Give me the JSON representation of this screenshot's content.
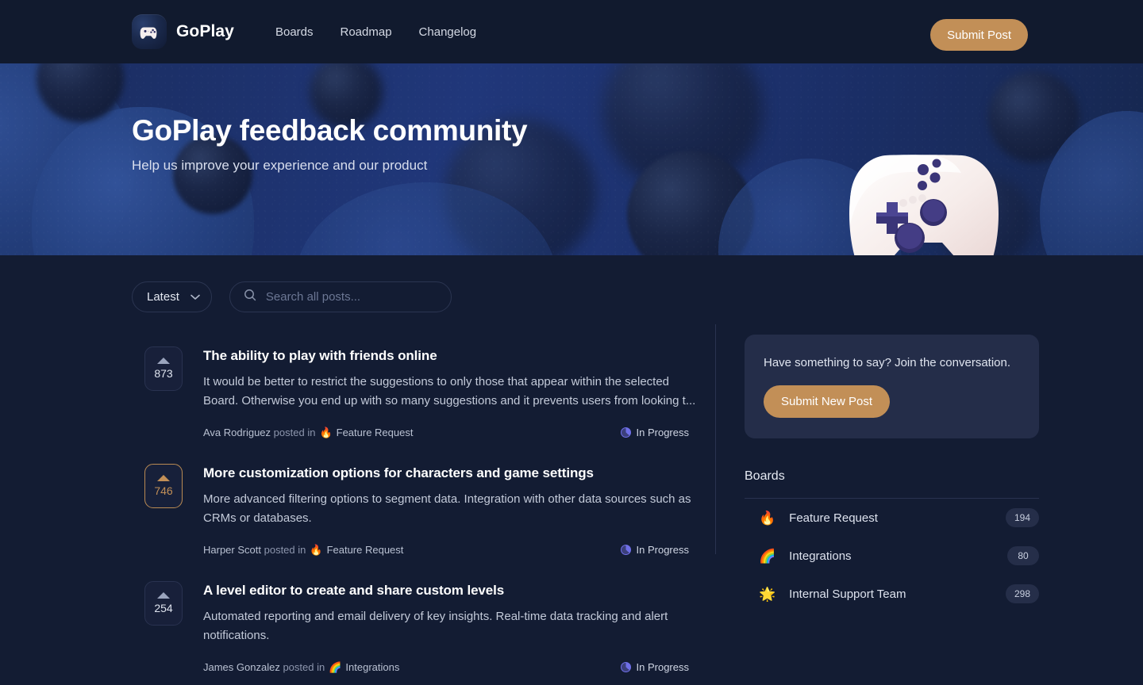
{
  "header": {
    "logo_icon": "gamepad-logo-icon",
    "brand": "GoPlay",
    "nav": [
      {
        "label": "Boards"
      },
      {
        "label": "Roadmap"
      },
      {
        "label": "Changelog"
      }
    ],
    "submit_post_label": "Submit Post",
    "accent_color": "#c28f57",
    "background": "#111a2e"
  },
  "hero": {
    "title": "GoPlay feedback community",
    "subtitle": "Help us improve your experience and our product",
    "background": "#1f3578"
  },
  "toolbar": {
    "sort_value": "Latest",
    "sort_icon": "chevron-down-icon",
    "search_icon": "search-icon",
    "search_value": "",
    "search_placeholder": "Search all posts..."
  },
  "posts": [
    {
      "votes": "873",
      "voted": false,
      "title": "The ability to play with friends online",
      "description": "It would be better to restrict the suggestions to only those that appear within the selected Board.  Otherwise you end up with so many suggestions and it prevents users from looking t...",
      "author": "Ava Rodriguez",
      "posted_in": "posted in",
      "board_emoji": "🔥",
      "board": "Feature Request",
      "status": "In Progress"
    },
    {
      "votes": "746",
      "voted": true,
      "title": "More customization options for characters and game settings",
      "description": "More advanced filtering options to segment data. Integration with other data sources such as CRMs or databases.",
      "author": "Harper Scott",
      "posted_in": "posted in",
      "board_emoji": "🔥",
      "board": "Feature Request",
      "status": "In Progress"
    },
    {
      "votes": "254",
      "voted": false,
      "title": "A level editor to create and share custom levels",
      "description": "Automated reporting and email delivery of key insights. Real-time data tracking and alert notifications.",
      "author": "James Gonzalez",
      "posted_in": "posted in",
      "board_emoji": "🌈",
      "board": "Integrations",
      "status": "In Progress"
    }
  ],
  "sidebar": {
    "cta_text": "Have something to say? Join the conversation.",
    "cta_button": "Submit New Post",
    "boards_title": "Boards",
    "boards": [
      {
        "emoji": "🔥",
        "name": "Feature Request",
        "count": "194"
      },
      {
        "emoji": "🌈",
        "name": "Integrations",
        "count": "80"
      },
      {
        "emoji": "🌟",
        "name": "Internal Support Team",
        "count": "298"
      }
    ]
  }
}
